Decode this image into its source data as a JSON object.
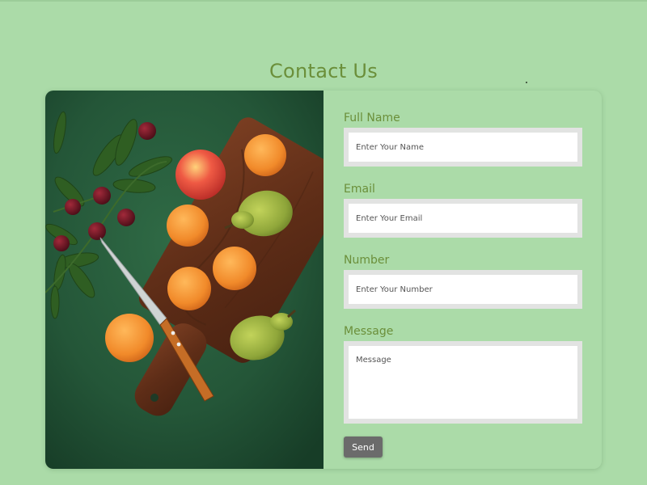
{
  "header": {
    "title": "Contact Us"
  },
  "image": {
    "icon": "fruit-cutting-board-photo"
  },
  "form": {
    "full_name": {
      "label": "Full Name",
      "value": "",
      "placeholder": "Enter Your Name"
    },
    "email": {
      "label": "Email",
      "value": "",
      "placeholder": "Enter Your Email"
    },
    "number": {
      "label": "Number",
      "value": "",
      "placeholder": "Enter Your Number"
    },
    "message": {
      "label": "Message",
      "value": "",
      "placeholder": "Message"
    },
    "send_label": "Send"
  },
  "colors": {
    "page_background": "#abdba8",
    "title_text": "#6b8f3a",
    "label_text": "#6b8f3a",
    "field_border": "#e2e3e2",
    "button_background": "#6b6b6b",
    "button_text": "#ffffff"
  }
}
